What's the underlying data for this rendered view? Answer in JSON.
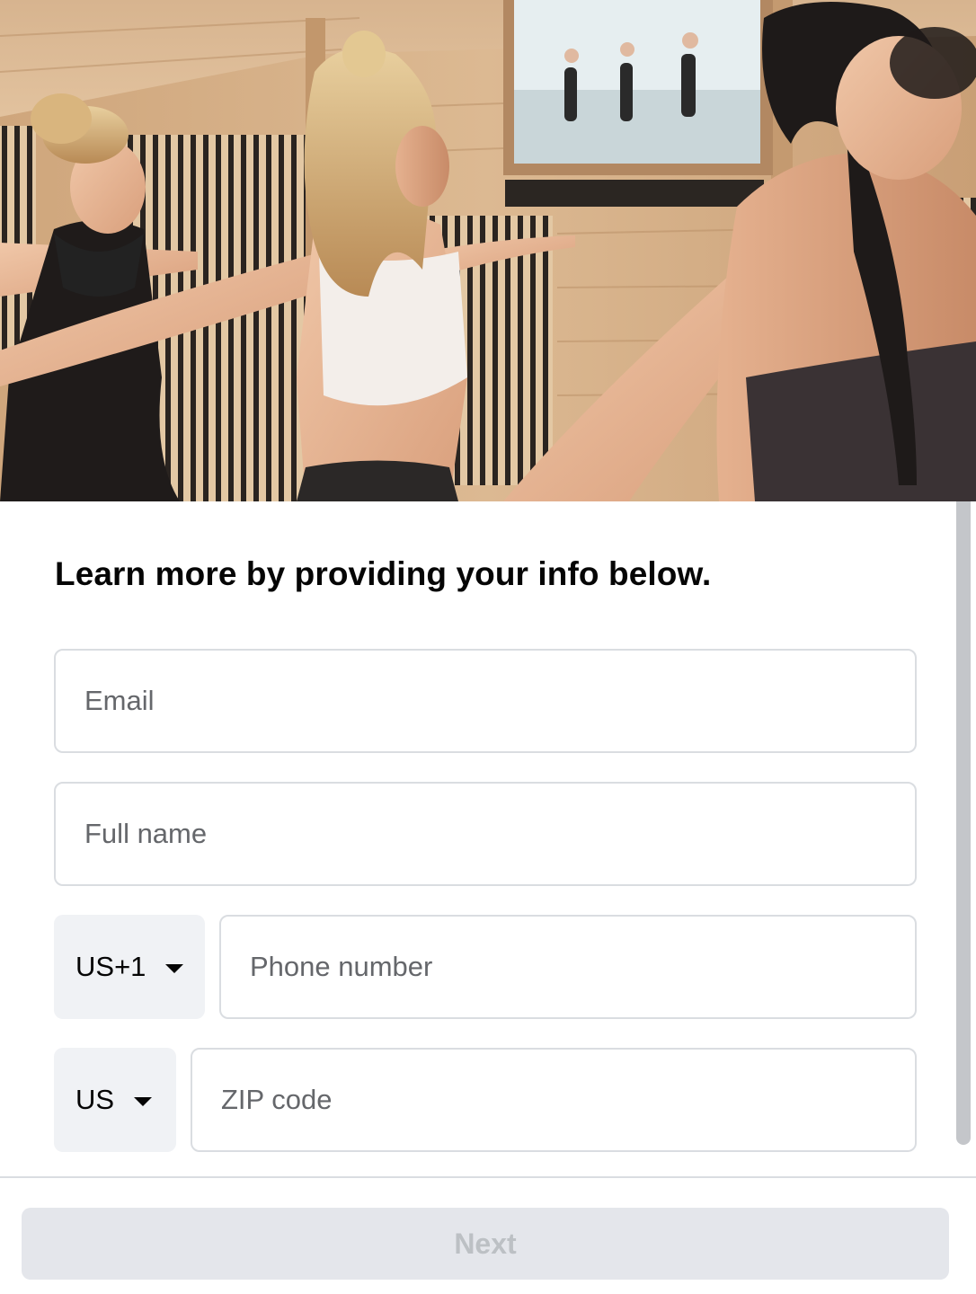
{
  "hero": {
    "image_alt": "Three women doing a warrior yoga pose in a wooden infrared sauna studio with a screen showing a yoga class"
  },
  "form": {
    "heading": "Learn more by providing your info below.",
    "email": {
      "placeholder": "Email",
      "value": ""
    },
    "full_name": {
      "placeholder": "Full name",
      "value": ""
    },
    "phone": {
      "country_code": "US+1",
      "placeholder": "Phone number",
      "value": ""
    },
    "zip": {
      "country": "US",
      "placeholder": "ZIP code",
      "value": ""
    }
  },
  "footer": {
    "next_label": "Next"
  },
  "colors": {
    "field_border": "#dadde1",
    "select_bg": "#f0f2f5",
    "button_disabled_bg": "#e4e6eb",
    "button_disabled_text": "#bcc0c4",
    "placeholder": "#65676b"
  }
}
